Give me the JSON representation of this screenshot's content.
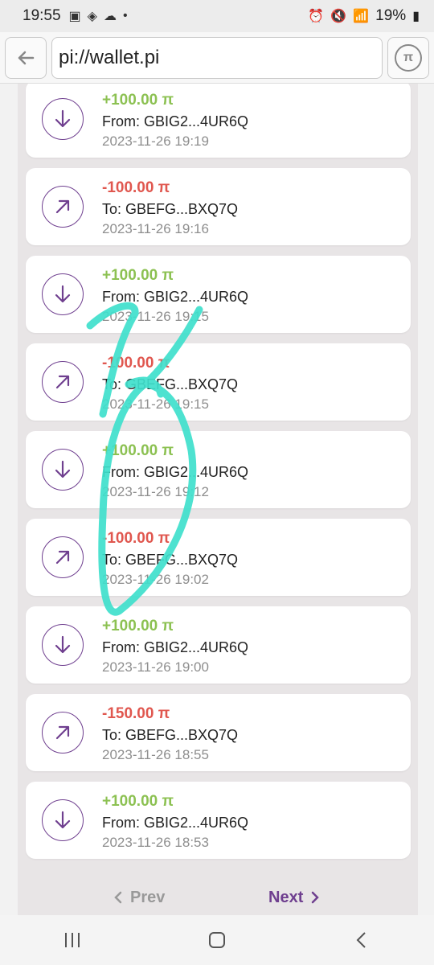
{
  "status_bar": {
    "time": "19:55",
    "battery": "19%"
  },
  "browser": {
    "url": "pi://wallet.pi"
  },
  "colors": {
    "incoming": "#8cc152",
    "outgoing": "#e0574f",
    "accent": "#6f3f8f",
    "scribble": "#3fe0cc"
  },
  "transactions": [
    {
      "direction": "in",
      "amount": "+100.00 π",
      "party": "From: GBIG2...4UR6Q",
      "date": "2023-11-26 19:19",
      "icon": "arrow-down-icon"
    },
    {
      "direction": "out",
      "amount": "-100.00 π",
      "party": "To: GBEFG...BXQ7Q",
      "date": "2023-11-26 19:16",
      "icon": "arrow-up-right-icon"
    },
    {
      "direction": "in",
      "amount": "+100.00 π",
      "party": "From: GBIG2...4UR6Q",
      "date": "2023-11-26 19:15",
      "icon": "arrow-down-icon"
    },
    {
      "direction": "out",
      "amount": "-100.00 π",
      "party": "To: GBEFG...BXQ7Q",
      "date": "2023-11-26 19:15",
      "icon": "arrow-up-right-icon"
    },
    {
      "direction": "in",
      "amount": "+100.00 π",
      "party": "From: GBIG2...4UR6Q",
      "date": "2023-11-26 19:12",
      "icon": "arrow-down-icon"
    },
    {
      "direction": "out",
      "amount": "-100.00 π",
      "party": "To: GBEFG...BXQ7Q",
      "date": "2023-11-26 19:02",
      "icon": "arrow-up-right-icon"
    },
    {
      "direction": "in",
      "amount": "+100.00 π",
      "party": "From: GBIG2...4UR6Q",
      "date": "2023-11-26 19:00",
      "icon": "arrow-down-icon"
    },
    {
      "direction": "out",
      "amount": "-150.00 π",
      "party": "To: GBEFG...BXQ7Q",
      "date": "2023-11-26 18:55",
      "icon": "arrow-up-right-icon"
    },
    {
      "direction": "in",
      "amount": "+100.00 π",
      "party": "From: GBIG2...4UR6Q",
      "date": "2023-11-26 18:53",
      "icon": "arrow-down-icon"
    }
  ],
  "pager": {
    "prev_label": "Prev",
    "next_label": "Next"
  }
}
